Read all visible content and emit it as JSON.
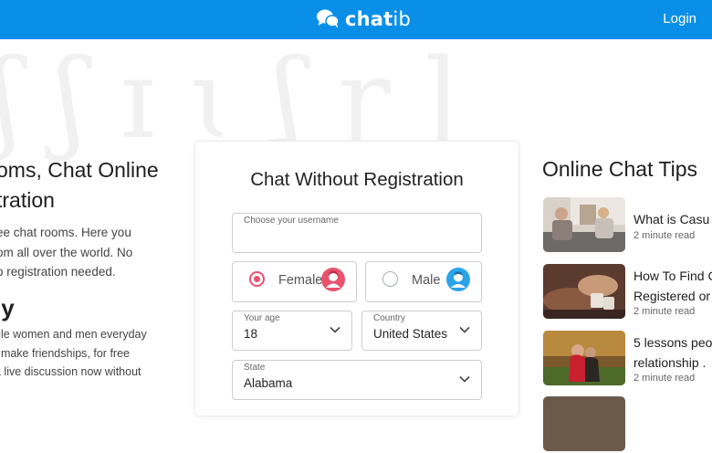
{
  "header": {
    "logo_bold": "chat",
    "logo_light": "ib",
    "login_label": "Login",
    "brand_color": "#0a8fe8"
  },
  "left": {
    "title_line1": "oms, Chat Online",
    "title_line2": "tration",
    "desc_line1": "ee chat rooms. Here you",
    "desc_line2": "om all over the world. No",
    "desc_line3": "o registration needed.",
    "subheading": "ly",
    "subdesc_line1": "gle women and men everyday",
    "subdesc_line2": ", make friendships, for free",
    "subdesc_line3": "a live discussion now without"
  },
  "form": {
    "title": "Chat Without Registration",
    "username_label": "Choose your username",
    "username_value": "",
    "gender_female": "Female",
    "gender_male": "Male",
    "selected_gender": "Female",
    "age_label": "Your age",
    "age_value": "18",
    "country_label": "Country",
    "country_value": "United States",
    "state_label": "State",
    "state_value": "Alabama",
    "female_color": "#e8526f",
    "male_color": "#2aa3e8"
  },
  "tips": {
    "title": "Online Chat Tips",
    "items": [
      {
        "title_line1": "What is Casu",
        "title_line2": "",
        "meta": "2 minute read"
      },
      {
        "title_line1": "How To Find C",
        "title_line2": "Registered or",
        "meta": "2 minute read"
      },
      {
        "title_line1": "5 lessons peo",
        "title_line2": "relationship .",
        "meta": "2 minute read"
      }
    ]
  }
}
